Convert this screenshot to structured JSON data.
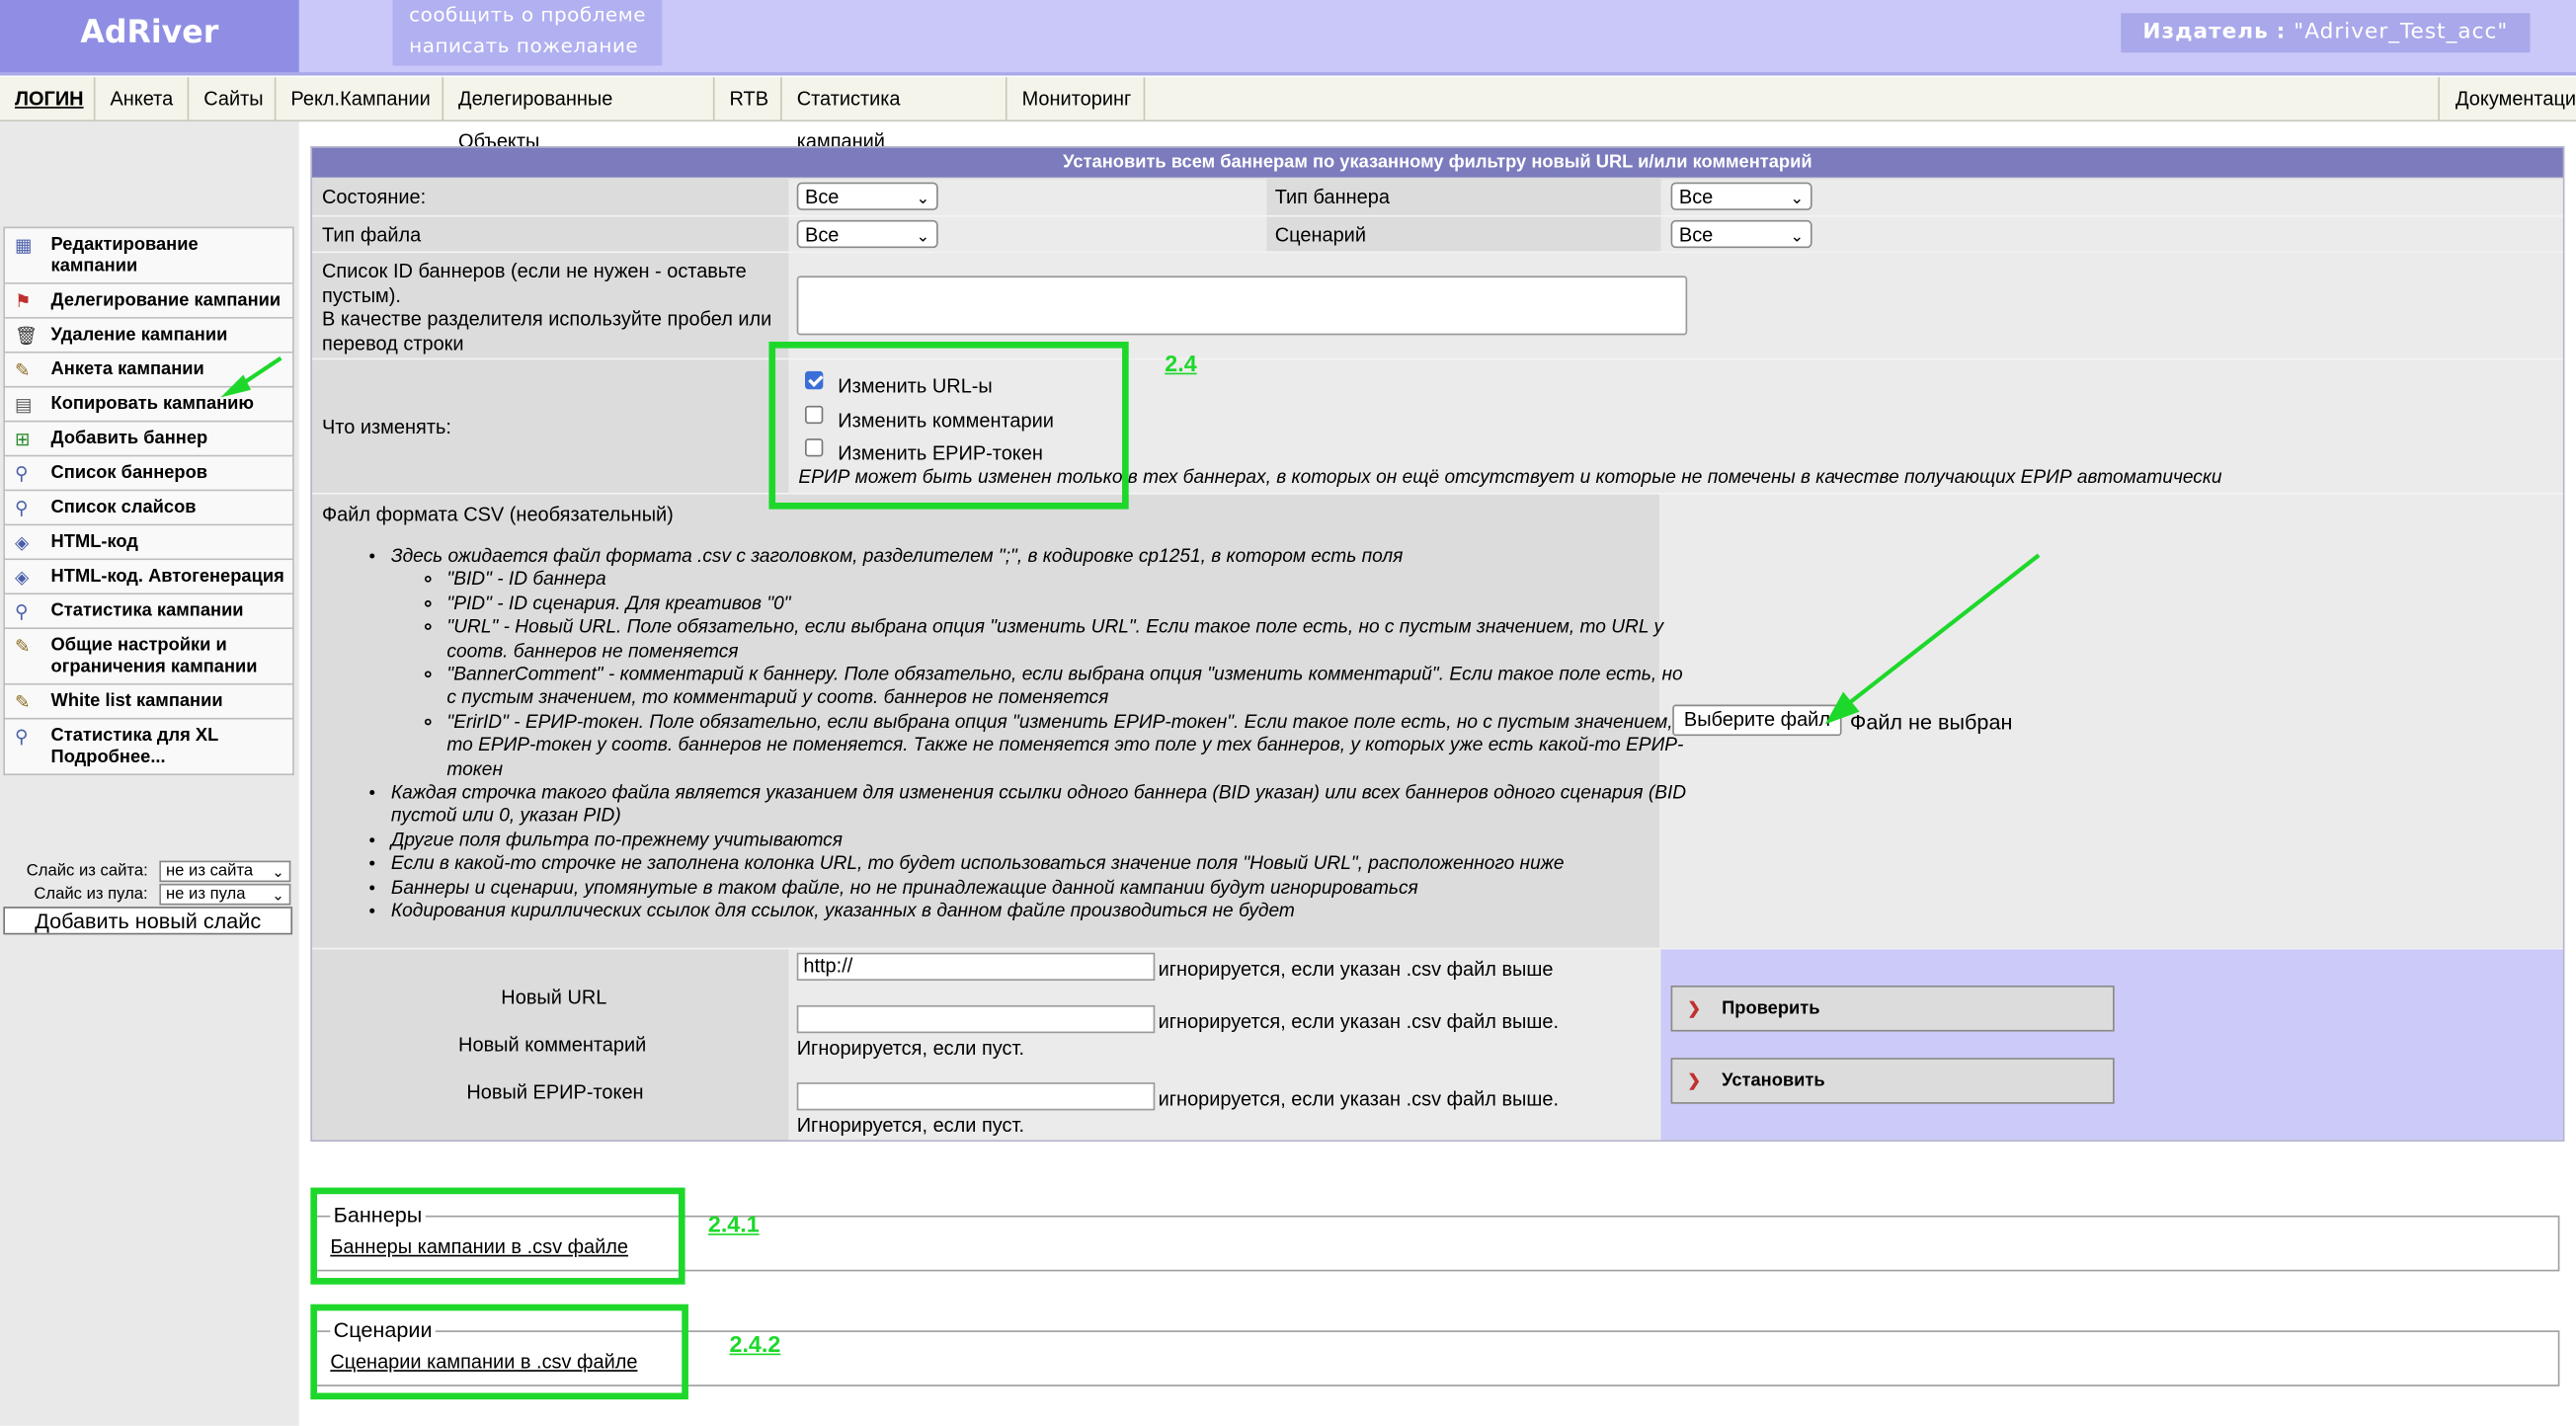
{
  "header": {
    "logo": "AdRiver",
    "feedback": [
      "сообщить о проблеме",
      "написать пожелание"
    ],
    "publisher_label": "Издатель",
    "publisher_sep": ":",
    "publisher_value": "\"Adriver_Test_acc\""
  },
  "nav": {
    "items": [
      "ЛОГИН",
      "Анкета",
      "Сайты",
      "Рекл.Кампании",
      "Делегированные Объекты",
      "RTB",
      "Статистика кампаний",
      "Мониторинг"
    ],
    "docs": "Документаци"
  },
  "sidebar": {
    "items": [
      "Редактирование кампании",
      "Делегирование кампании",
      "Удаление кампании",
      "Анкета кампании",
      "Копировать кампанию",
      "Добавить баннер",
      "Список баннеров",
      "Список слайсов",
      "HTML-код",
      "HTML-код. Автогенерация",
      "Статистика кампании",
      "Общие настройки и ограничения кампании",
      "White list кампании",
      "Статистика для XL Подробнее..."
    ],
    "icons": [
      "grid-icon",
      "flag-icon",
      "trash-icon",
      "pencil-icon",
      "document-icon",
      "add-banner-icon",
      "magnifier-icon",
      "magnifier-icon",
      "code-icon",
      "code-icon",
      "magnifier-icon",
      "pencil-icon",
      "pencil-icon",
      "magnifier-icon"
    ],
    "slice_site_label": "Слайс из сайта:",
    "slice_site_value": "не из сайта",
    "slice_pool_label": "Слайс из пула:",
    "slice_pool_value": "не из пула",
    "add_slice": "Добавить новый слайс"
  },
  "form": {
    "title": "Установить всем баннерам по указанному фильтру новый URL и/или комментарий",
    "state_label": "Состояние:",
    "state_value": "Все",
    "banner_type_label": "Тип баннера",
    "banner_type_value": "Все",
    "file_type_label": "Тип файла",
    "file_type_value": "Все",
    "scenario_label": "Сценарий",
    "scenario_value": "Все",
    "ids_label": [
      "Список ID баннеров (если не нужен - оставьте",
      "пустым).",
      "В качестве разделителя используйте пробел или",
      "перевод строки"
    ],
    "what_label": "Что изменять:",
    "cb_urls": "Изменить URL-ы",
    "cb_comments": "Изменить комментарии",
    "cb_erir": "Изменить ЕРИР-токен",
    "erir_note": "ЕРИР может быть изменен только в тех баннерах, в которых он ещё отсутствует и которые не помечены в качестве получающих ЕРИР автоматически",
    "csv_label": "Файл формата CSV (необязательный)",
    "csv_intro": "Здесь ожидается файл формата .csv с заголовком, разделителем \";\", в кодировке cp1251, в котором есть поля",
    "csv_fields": [
      "\"BID\" - ID баннера",
      "\"PID\" - ID сценария. Для креативов \"0\"",
      "\"URL\" - Новый URL. Поле обязательно, если выбрана опция \"изменить URL\". Если такое поле есть, но с пустым значением, то URL у соотв. баннеров не поменяется",
      "\"BannerComment\" - комментарий к баннеру. Поле обязательно, если выбрана опция \"изменить комментарий\". Если такое поле есть, но с пустым значением, то комментарий у соотв. баннеров не поменяется",
      "\"ErirID\" - ЕРИР-токен. Поле обязательно, если выбрана опция \"изменить ЕРИР-токен\". Если такое поле есть, но с пустым значением, то ЕРИР-токен у соотв. баннеров не поменяется. Также не поменяется это поле у тех баннеров, у которых уже есть какой-то ЕРИР-токен"
    ],
    "csv_notes": [
      "Каждая строчка такого файла является указанием для изменения ссылки одного баннера (BID указан) или всех баннеров одного сценария (BID пустой или 0, указан PID)",
      "Другие поля фильтра по-прежнему учитываются",
      "Если в какой-то строчке не заполнена колонка URL, то будет использоваться значение поля \"Новый URL\", расположенного ниже",
      "Баннеры и сценарии, упомянутые в таком файле, но не принадлежащие данной кампании будут игнорироваться",
      "Кодирования кириллических ссылок для ссылок, указанных в данном файле производиться не будет"
    ],
    "file_button": "Выберите файл",
    "file_status": "Файл не выбран",
    "new_url_label": "Новый URL",
    "new_url_value": "http://",
    "new_url_hint": "игнорируется, если указан .csv файл выше",
    "new_comment_label": "Новый комментарий",
    "new_comment_hint": "игнорируется, если указан .csv файл выше.",
    "new_comment_hint2": "Игнорируется, если пуст.",
    "new_erir_label": "Новый ЕРИР-токен",
    "new_erir_hint": "игнорируется, если указан .csv файл выше.",
    "new_erir_hint2": "Игнорируется, если пуст.",
    "check_button": "Проверить",
    "set_button": "Установить"
  },
  "banners": {
    "legend": "Баннеры",
    "link": "Баннеры кампании в .csv файле"
  },
  "scenarios": {
    "legend": "Сценарии",
    "link": "Сценарии кампании в .csv файле"
  },
  "annotations": {
    "step_main": "2.4",
    "step_banners": "2.4.1",
    "step_scenarios": "2.4.2",
    "color": "#1dd82a"
  }
}
